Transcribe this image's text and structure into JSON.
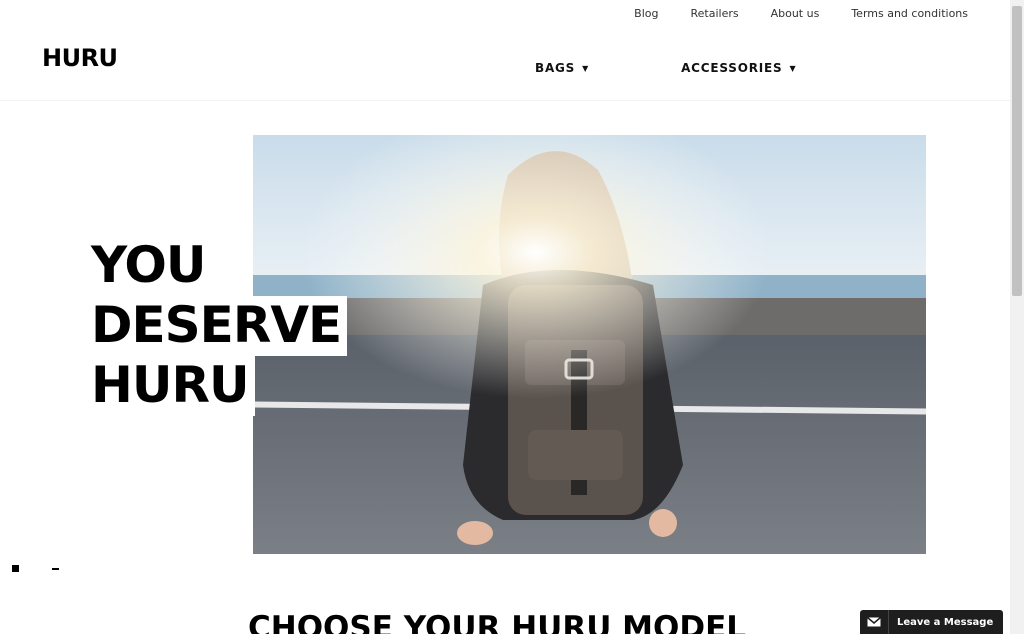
{
  "utility_links": [
    "Blog",
    "Retailers",
    "About us",
    "Terms and conditions"
  ],
  "logo": {
    "text": "HURU"
  },
  "nav": {
    "items": [
      {
        "label": "BAGS",
        "icon": "caret-down-icon"
      },
      {
        "label": "ACCESSORIES",
        "icon": "caret-down-icon"
      }
    ]
  },
  "hero": {
    "headline_lines": [
      "YOU",
      "DESERVE",
      "HURU"
    ],
    "slider": {
      "slides": 2,
      "active": 1
    }
  },
  "section": {
    "title": "CHOOSE YOUR HURU MODEL"
  },
  "chat": {
    "label": "Leave a Message",
    "icon": "envelope-icon"
  },
  "colors": {
    "text": "#000000",
    "chat_bg": "#1e1e1e",
    "background": "#ffffff"
  }
}
